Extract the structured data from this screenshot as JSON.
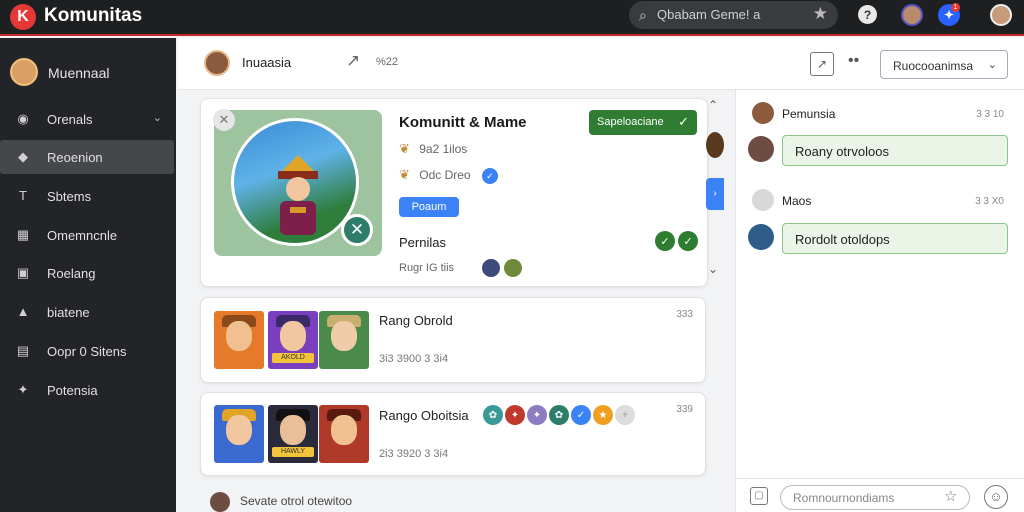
{
  "app": {
    "brand": "Komunitas",
    "logo_glyph": "K",
    "accent": "#e53935"
  },
  "topbar": {
    "search_value": "Qbabam Geme! ",
    "search_suffix": "a",
    "help_glyph": "?",
    "notification_badge": "1"
  },
  "sidebar": {
    "user_name": "Muennaal",
    "items": [
      {
        "label": "Orenals",
        "icon": "◉",
        "has_chevron": true
      },
      {
        "label": "Reoenion",
        "icon": "◆",
        "active": true
      },
      {
        "label": "Sbtems",
        "icon": "T"
      },
      {
        "label": "Omemncnle",
        "icon": "▦"
      },
      {
        "label": "Roelang",
        "icon": "▣"
      },
      {
        "label": "biatene",
        "icon": "▲"
      },
      {
        "label": "Oopr 0 Sitens",
        "icon": "▤"
      },
      {
        "label": "Potensia",
        "icon": "✦"
      }
    ]
  },
  "header": {
    "title": "Inuaasia",
    "count": "%22",
    "select_value": "Ruocooanimsa",
    "more_glyph": "••"
  },
  "card1": {
    "title": "Komunitt & Mame",
    "row1": "9a2  1ilos",
    "row2": "Odc  Dreo",
    "blue_button": "Poaum",
    "permissions_label": "Pernilas",
    "footer": "Rugr  IG tiis",
    "green_button": "Sapeloaciane",
    "green_button_icon": "✓"
  },
  "card2": {
    "title": "Rang Obrold",
    "meta": "3i3  3900  3 3i4",
    "time": "333",
    "tag": "AKOLD"
  },
  "card3": {
    "title": "Rango Oboitsia",
    "meta": "2i3  3920  3 3i4",
    "time": "339",
    "tag": "HAWLY"
  },
  "bottom": {
    "text": "Sevate  otrol  otewitoo"
  },
  "chat": {
    "messages": [
      {
        "user": "Pemunsia",
        "time": "3 3 10",
        "bubble": "Roany otrvoloos"
      },
      {
        "user": "Maos",
        "time": "3 3 X0",
        "bubble": "Rordolt otoldops"
      }
    ],
    "input_placeholder": "Romnournondiams"
  }
}
